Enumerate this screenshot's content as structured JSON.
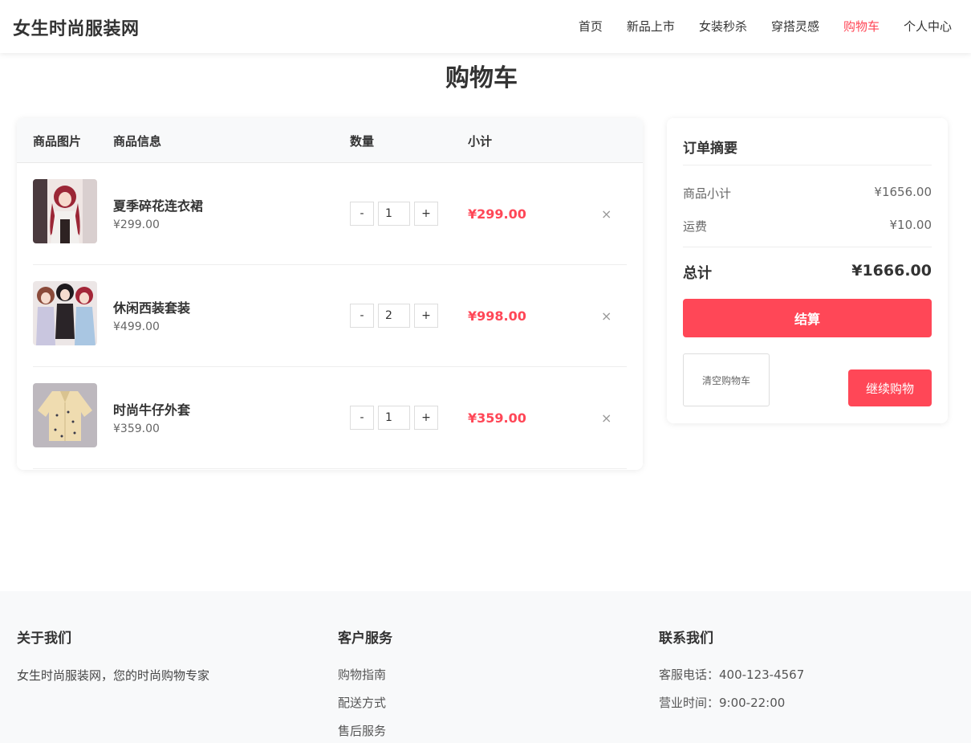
{
  "header": {
    "logo": "女生时尚服装网",
    "nav": [
      {
        "label": "首页",
        "active": false
      },
      {
        "label": "新品上市",
        "active": false
      },
      {
        "label": "女装秒杀",
        "active": false
      },
      {
        "label": "穿搭灵感",
        "active": false
      },
      {
        "label": "购物车",
        "active": true
      },
      {
        "label": "个人中心",
        "active": false
      }
    ]
  },
  "page_title": "购物车",
  "cart": {
    "columns": [
      "商品图片",
      "商品信息",
      "数量",
      "小计"
    ],
    "items": [
      {
        "name": "夏季碎花连衣裙",
        "price": "¥299.00",
        "qty": "1",
        "subtotal": "¥299.00",
        "image_icon": "dress-photo"
      },
      {
        "name": "休闲西装套装",
        "price": "¥499.00",
        "qty": "2",
        "subtotal": "¥998.00",
        "image_icon": "suit-photo"
      },
      {
        "name": "时尚牛仔外套",
        "price": "¥359.00",
        "qty": "1",
        "subtotal": "¥359.00",
        "image_icon": "jacket-photo"
      }
    ],
    "minus_label": "-",
    "plus_label": "+",
    "remove_label": "×"
  },
  "summary": {
    "title": "订单摘要",
    "subtotal_label": "商品小计",
    "subtotal_value": "¥1656.00",
    "shipping_label": "运费",
    "shipping_value": "¥10.00",
    "total_label": "总计",
    "total_value": "¥1666.00",
    "checkout_label": "结算",
    "clear_label": "清空购物车",
    "continue_label": "继续购物"
  },
  "footer": {
    "about": {
      "title": "关于我们",
      "text": "女生时尚服装网，您的时尚购物专家"
    },
    "service": {
      "title": "客户服务",
      "links": [
        "购物指南",
        "配送方式",
        "售后服务"
      ]
    },
    "contact": {
      "title": "联系我们",
      "phone": "客服电话：400-123-4567",
      "hours": "营业时间：9:00-22:00"
    }
  },
  "colors": {
    "accent": "#ff4757",
    "text": "#333333",
    "muted": "#666666",
    "footer_bg": "#f8f9fa"
  }
}
